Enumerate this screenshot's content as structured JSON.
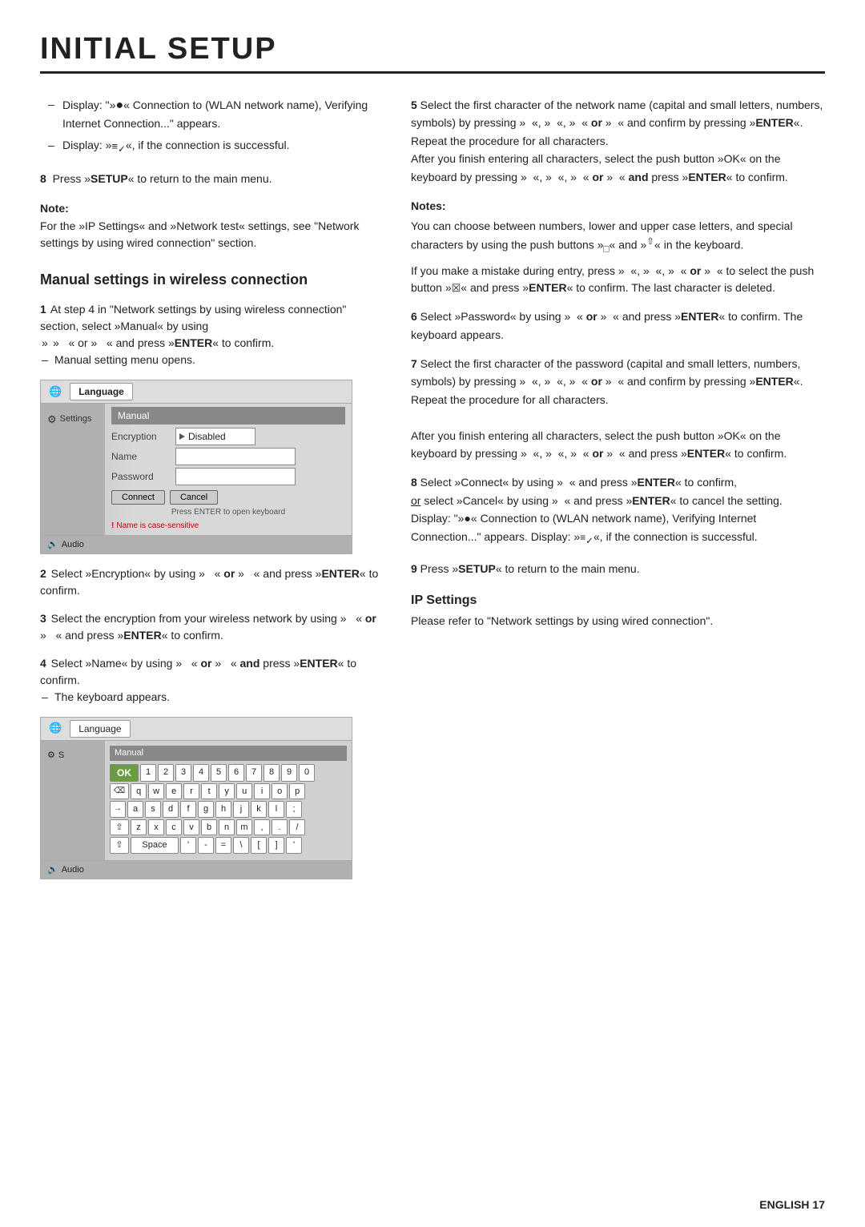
{
  "page": {
    "title": "INITIAL SETUP",
    "footer": "ENGLISH  17"
  },
  "left_col": {
    "top_bullets": [
      "Display: \"»  « Connection to (WLAN network name), Verifying Internet Connection...\" appears.",
      "Display: »  «, if the connection is successful."
    ],
    "press_setup": "8  Press »SETUP« to return to the main menu.",
    "note": {
      "title": "Note:",
      "text": "For the »IP Settings« and »Network test« settings, see \"Network settings by using wired connection\" section."
    },
    "section_title": "Manual settings in wireless connection",
    "steps": [
      {
        "num": "1",
        "text": "At step 4 in \"Network settings by using wireless connection\" section, select »Manual« by using",
        "subs": [
          "» « or » « and press »ENTER« to confirm.",
          "Manual setting menu opens."
        ],
        "sub_types": [
          "arrow",
          "dash"
        ]
      },
      {
        "num": "2",
        "text": "Select »Encryption« by using »   « or »   « and press »ENTER« to confirm."
      },
      {
        "num": "3",
        "text": "Select the encryption from your wireless network by using »   « or »   « and press »ENTER« to confirm."
      },
      {
        "num": "4",
        "text": "Select »Name« by using »   « or »   « and press »ENTER« to confirm.",
        "subs": [
          "The keyboard appears."
        ],
        "sub_types": [
          "dash"
        ]
      }
    ],
    "menu_screenshot": {
      "tab": "Language",
      "title": "Manual",
      "rows": [
        {
          "label": "Encryption",
          "value": "▶ Disabled"
        },
        {
          "label": "Name",
          "value": ""
        },
        {
          "label": "Password",
          "value": ""
        }
      ],
      "buttons": [
        "Connect",
        "Cancel"
      ],
      "hint": "Press ENTER to open keyboard",
      "warning": "Name is case-sensitive",
      "sidebar_items": [
        "Settings"
      ]
    },
    "keyboard_screenshot": {
      "tab": "Language",
      "title": "Manual",
      "rows": [
        [
          "OK",
          "1",
          "2",
          "3",
          "4",
          "5",
          "6",
          "7",
          "8",
          "9",
          "0"
        ],
        [
          "⌫",
          "q",
          "w",
          "e",
          "r",
          "t",
          "y",
          "u",
          "i",
          "o",
          "p"
        ],
        [
          "→",
          "a",
          "s",
          "d",
          "f",
          "g",
          "h",
          "j",
          "k",
          "l",
          ";"
        ],
        [
          "⇧",
          "z",
          "x",
          "c",
          "v",
          "b",
          "n",
          "m",
          ",",
          ".",
          "/"
        ],
        [
          "⇧",
          "Space",
          "'",
          "-",
          "=",
          "\\",
          "[",
          "]",
          "'"
        ]
      ],
      "sidebar_items": [
        "Settings"
      ],
      "audio_label": "Audio"
    }
  },
  "right_col": {
    "steps": [
      {
        "num": "5",
        "text": "Select the first character of the network name (capital and small letters, numbers, symbols) by pressing »   «, »   «, »   « or »   « and confirm by pressing »ENTER«.",
        "extra": [
          "Repeat the procedure for all characters.",
          "After you finish entering all characters, select the push button »OK« on the keyboard by pressing »   «, »   «, »   « or »   « and press »ENTER« to confirm."
        ]
      }
    ],
    "notes": {
      "title": "Notes:",
      "paragraphs": [
        "You can choose between numbers, lower and upper case letters, and special characters by using the push buttons »  « and »  « in the keyboard.",
        "If you make a mistake during entry, press »   «, »   «, »   « or »   « to select the push button »  « and press »ENTER« to confirm. The last character is deleted."
      ]
    },
    "steps2": [
      {
        "num": "6",
        "text": "Select »Password« by using »   « or »   « and press »ENTER« to confirm.",
        "subs": [
          "The keyboard appears."
        ],
        "sub_types": [
          "dash"
        ]
      },
      {
        "num": "7",
        "text": "Select the first character of the password (capital and small letters, numbers, symbols) by pressing »   «, »   «, »   « or »   « and confirm by pressing »ENTER«. Repeat the procedure for all characters.",
        "extra": [
          "After you finish entering all characters, select the push button »OK« on the keyboard by pressing »   «, »   «, »   « or »   « and press »ENTER« to confirm."
        ]
      },
      {
        "num": "8",
        "text": "Select »Connect« by using »   « and press »ENTER« to confirm,",
        "or_text": "or select »Cancel« by using »   « and press »ENTER« to cancel the setting.",
        "subs": [
          "Display: \"»  « Connection to (WLAN network name), Verifying Internet Connection...\" appears.",
          "Display: »  «, if the connection is successful."
        ],
        "sub_types": [
          "dash",
          "dash"
        ]
      },
      {
        "num": "9",
        "text": "Press »SETUP« to return to the main menu."
      }
    ],
    "ip_section": {
      "title": "IP Settings",
      "text": "Please refer to \"Network settings by using wired connection\"."
    }
  }
}
